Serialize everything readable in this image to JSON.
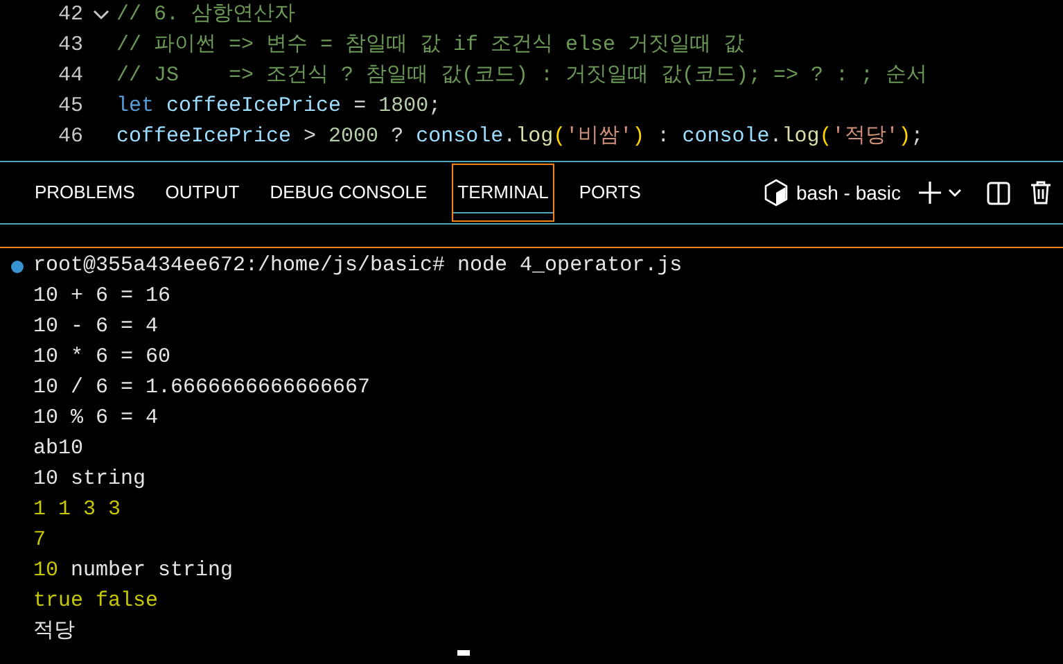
{
  "editor": {
    "lines": [
      {
        "number": "42",
        "foldable": true,
        "tokens": [
          {
            "kind": "comment",
            "text": "// 6. 삼항연산자"
          }
        ]
      },
      {
        "number": "43",
        "foldable": false,
        "tokens": [
          {
            "kind": "comment",
            "text": "// 파이썬 => 변수 = 참일때 값 if 조건식 else 거짓일때 값"
          }
        ]
      },
      {
        "number": "44",
        "foldable": false,
        "tokens": [
          {
            "kind": "comment",
            "text": "// JS    => 조건식 ? 참일때 값(코드) : 거짓일때 값(코드); => ? : ; 순서"
          }
        ]
      },
      {
        "number": "45",
        "foldable": false,
        "tokens": [
          {
            "kind": "keyword",
            "text": "let"
          },
          {
            "kind": "variable",
            "text": "coffeeIcePrice"
          },
          {
            "kind": "plain",
            "text": " = "
          },
          {
            "kind": "number",
            "text": "1800"
          },
          {
            "kind": "plain",
            "text": ";"
          }
        ]
      },
      {
        "number": "46",
        "foldable": false,
        "tokens": [
          {
            "kind": "variable",
            "text": "coffeeIcePrice"
          },
          {
            "kind": "plain",
            "text": " > "
          },
          {
            "kind": "number",
            "text": "2000"
          },
          {
            "kind": "plain",
            "text": " ? "
          },
          {
            "kind": "variable",
            "text": "console"
          },
          {
            "kind": "plain",
            "text": "."
          },
          {
            "kind": "function",
            "text": "log"
          },
          {
            "kind": "paren",
            "text": "("
          },
          {
            "kind": "string",
            "text": "'비쌈'"
          },
          {
            "kind": "paren",
            "text": ")"
          },
          {
            "kind": "plain",
            "text": " : "
          },
          {
            "kind": "variable",
            "text": "console"
          },
          {
            "kind": "plain",
            "text": "."
          },
          {
            "kind": "function",
            "text": "log"
          },
          {
            "kind": "paren",
            "text": "("
          },
          {
            "kind": "string",
            "text": "'적당'"
          },
          {
            "kind": "paren",
            "text": ")"
          },
          {
            "kind": "plain",
            "text": ";"
          }
        ]
      }
    ]
  },
  "panel": {
    "tabs": [
      {
        "label": "PROBLEMS",
        "selected": false
      },
      {
        "label": "OUTPUT",
        "selected": false
      },
      {
        "label": "DEBUG CONSOLE",
        "selected": false
      },
      {
        "label": "TERMINAL",
        "selected": true
      },
      {
        "label": "PORTS",
        "selected": false
      }
    ],
    "terminal_name": "bash - basic"
  },
  "terminal": {
    "prompt": "root@355a434ee672:/home/js/basic# node 4_operator.js",
    "lines": [
      [
        {
          "kind": "plain",
          "text": "10 + 6 = 16"
        }
      ],
      [
        {
          "kind": "plain",
          "text": "10 - 6 = 4"
        }
      ],
      [
        {
          "kind": "plain",
          "text": "10 * 6 = 60"
        }
      ],
      [
        {
          "kind": "plain",
          "text": "10 / 6 = 1.6666666666666667"
        }
      ],
      [
        {
          "kind": "plain",
          "text": "10 % 6 = 4"
        }
      ],
      [
        {
          "kind": "plain",
          "text": "ab10"
        }
      ],
      [
        {
          "kind": "plain",
          "text": "10 string"
        }
      ],
      [
        {
          "kind": "yellow",
          "text": "1 1 3 3"
        }
      ],
      [
        {
          "kind": "yellow",
          "text": "7"
        }
      ],
      [
        {
          "kind": "yellow",
          "text": "10"
        },
        {
          "kind": "plain",
          "text": " number string"
        }
      ],
      [
        {
          "kind": "yellow",
          "text": "true false"
        }
      ],
      [
        {
          "kind": "plain",
          "text": "적당"
        }
      ]
    ]
  }
}
